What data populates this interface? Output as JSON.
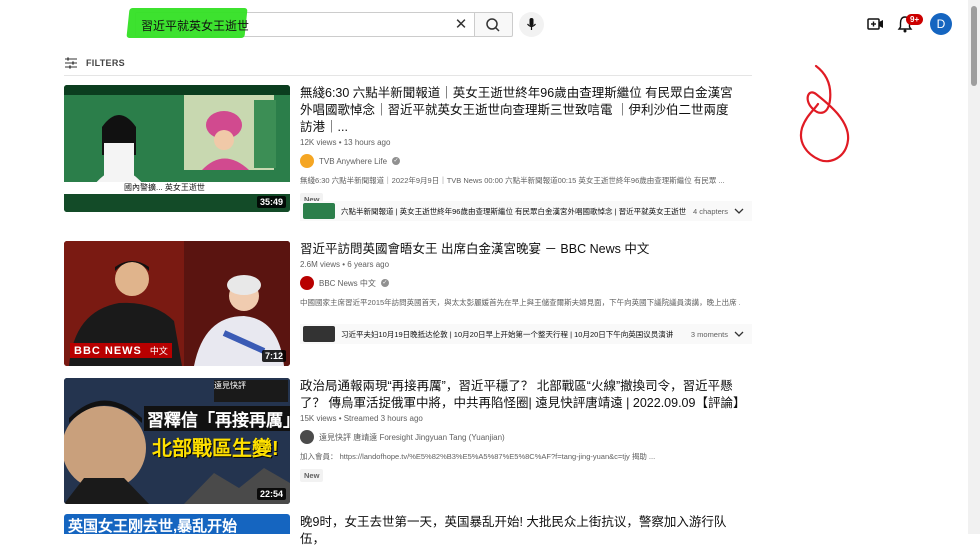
{
  "header": {
    "search_query": "習近平就英女王逝世",
    "clear_glyph": "✕",
    "notification_count": "9+",
    "avatar_letter": "D"
  },
  "filters": {
    "label": "FILTERS"
  },
  "videos": [
    {
      "title": "無綫6:30 六點半新聞報道｜英女王逝世終年96歲由查理斯繼位 有民眾白金漢宮外唱國歌悼念｜習近平就英女王逝世向查理斯三世致唁電 ｜伊利沙伯二世兩度訪港｜...",
      "views": "12K views",
      "age": "13 hours ago",
      "channel": "TVB Anywhere Life",
      "description": "無綫6:30 六點半新聞報道｜2022年9月9日｜TVB News 00:00 六點半新聞報道00:15 英女王逝世終年96歲由查理斯繼位 有民眾 ...",
      "badge": "New",
      "duration": "35:49",
      "chapter_text": "六點半新聞報道 | 英女王逝世終年96歲由查理斯繼位 有民眾白金漢宮外唱國歌悼念 | 習近平就英女王逝世 ...",
      "chapter_count": "4 chapters",
      "thumb_banner": "國內警擴... 英女王逝世"
    },
    {
      "title": "習近平訪問英國會晤女王 出席白金漢宮晚宴 － BBC News 中文",
      "views": "2.6M views",
      "age": "6 years ago",
      "channel": "BBC News 中文",
      "description": "中國國家主席習近平2015年訪問英國首天，與太太彭麗媛首先在早上與王儲查爾斯夫婦見面，下午向英國下議院議員演講，晚上出席 ...",
      "duration": "7:12",
      "chapter_text": "习近平夫妇10月19日晚抵达伦敦 | 10月20日早上开始第一个整天行程 | 10月20日下午向英国议员演讲",
      "chapter_count": "3 moments",
      "thumb_logo": "BBC NEWS",
      "thumb_logo_cn": "中文"
    },
    {
      "title": "政治局通報兩現“再接再厲”，習近平穩了？ 北部戰區“火線”撤換司令，習近平懸了？ 傳烏軍活捉俄軍中將，中共再陷怪圈| 遠見快評唐靖遠 | 2022.09.09【評論】",
      "views": "15K views",
      "age": "Streamed 3 hours ago",
      "channel": "遠見快評 唐靖遠 Foresight Jingyuan Tang (Yuanjian)",
      "description": "加入會員： https://landofhope.tv/%E5%82%B3%E5%A5%87%E5%8C%AF?f=tang-jing-yuan&c=tjy 揭助 ...",
      "badge": "New",
      "duration": "22:54",
      "thumb_line1": "習釋信「再接再厲」",
      "thumb_line2": "北部戰區生變!",
      "thumb_corner": "遠見快評"
    },
    {
      "title": "晚9时，女王去世第一天，英国暴乱开始! 大批民众上街抗议，警察加入游行队伍，",
      "thumb_line1": "英国女王刚去世,暴乱开始"
    }
  ],
  "colors": {
    "highlight": "#33e024",
    "annotation": "#e01b24",
    "badge_red": "#cc0000",
    "avatar_blue": "#1565c0"
  }
}
